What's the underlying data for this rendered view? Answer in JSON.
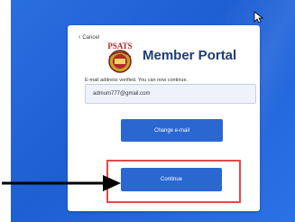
{
  "portal": {
    "cancel_label": "Cancel",
    "logo_text": "PSATS",
    "title": "Member Portal",
    "verified_message": "E-mail address verified. You can now continue.",
    "email_value": "admum777@gmail.com",
    "change_email_label": "Change e-mail",
    "continue_label": "Continue"
  },
  "icons": [
    "chevron-left-icon",
    "mouse-cursor-icon",
    "pointer-arrow-icon"
  ],
  "colors": {
    "background": "#2a6fe0",
    "title": "#1f3b74",
    "button": "#2b67d1",
    "highlight": "#e24a4a"
  }
}
